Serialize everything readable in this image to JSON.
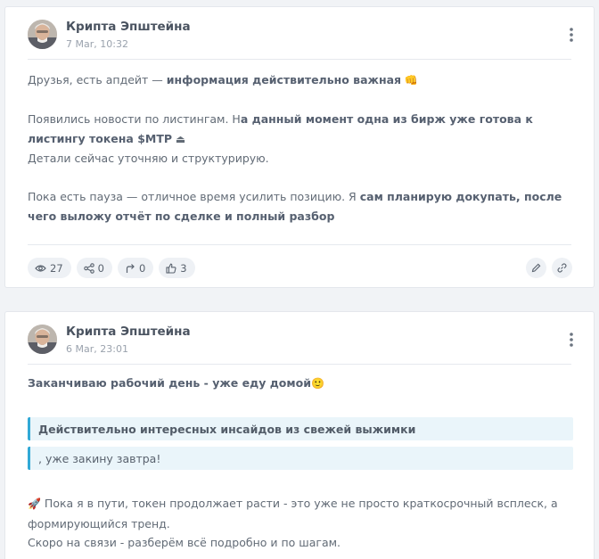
{
  "posts": [
    {
      "author": "Крипта Эпштейна",
      "date": "7 Mar, 10:32",
      "paragraphs": [
        [
          "Друзья, есть апдейт — ",
          "информация действительно важная",
          " 👊"
        ],
        [
          "Появились новости по листингам. Н",
          "а данный момент одна из бирж уже готова к листингу токена $MTP",
          " ⏏"
        ],
        [
          "Детали сейчас уточняю и структурирую."
        ],
        [
          "Пока есть пауза — отличное время усилить позицию. Я ",
          "сам планирую докупать, после чего выложу отчёт по сделке и полный разбор",
          ""
        ]
      ],
      "stats": {
        "views": "27",
        "shares": "0",
        "forwards": "0",
        "likes": "3"
      }
    },
    {
      "author": "Крипта Эпштейна",
      "date": "6 Mar, 23:01",
      "lead": "Заканчиваю рабочий день - уже еду домой",
      "lead_emoji": "🙂",
      "quote_title": "Действительно интересных инсайдов из свежей выжимки",
      "quote_text": ", уже закину завтра!",
      "rocket_emoji": "🚀",
      "body_line1": " Пока я в пути, токен продолжает расти - это уже не просто краткосрочный всплеск, а",
      "body_line2": "формирующийся тренд.",
      "body_line3": "Скоро на связи - разберём всё подробно и по шагам."
    }
  ],
  "icons": {
    "views": "eye-icon",
    "shares": "share-icon",
    "forwards": "forward-icon",
    "likes": "thumbs-up-icon",
    "edit": "pencil-icon",
    "link": "link-icon",
    "menu": "kebab-menu-icon"
  },
  "colors": {
    "quote_border": "#31a9d6",
    "quote_bg": "#eaf5fa",
    "pill_bg": "#eef1f5"
  }
}
